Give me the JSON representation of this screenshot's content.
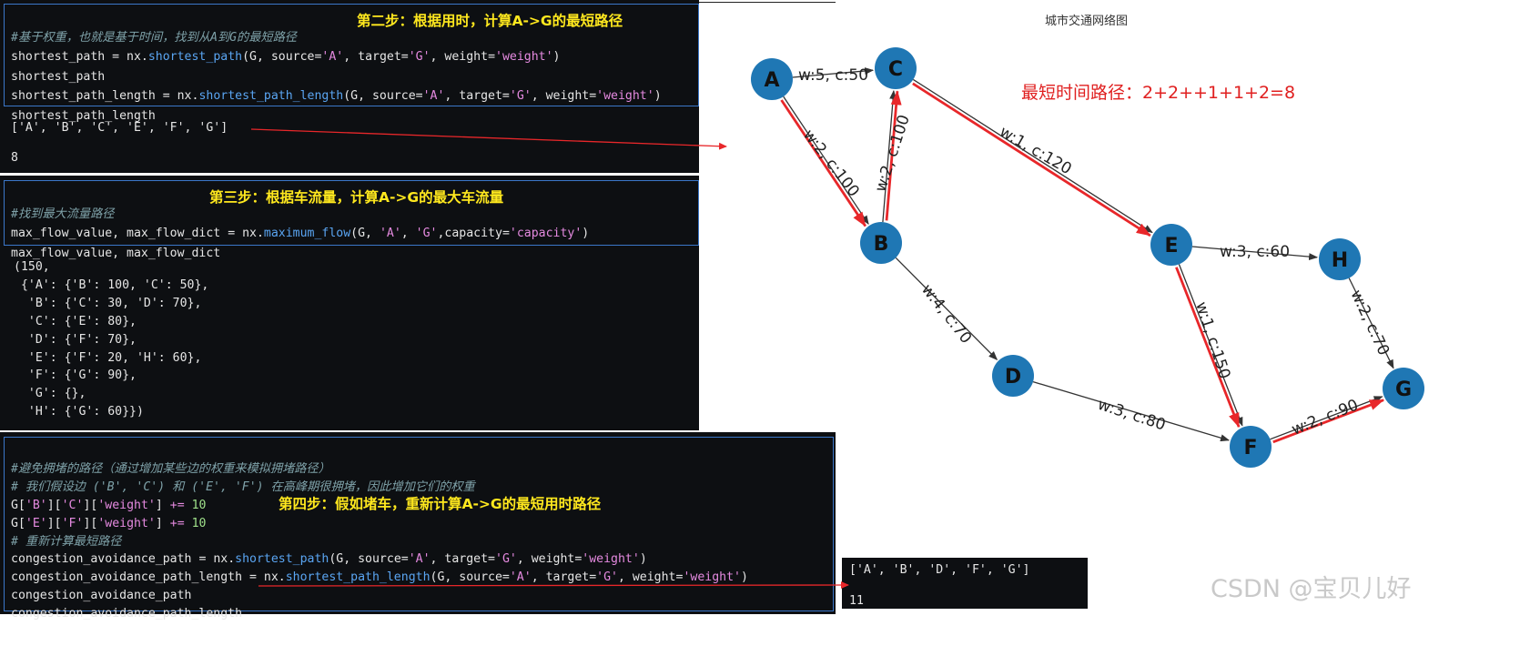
{
  "graph": {
    "title": "城市交通网络图",
    "path_note": "最短时间路径：2+2++1+1+2=8",
    "nodes": [
      {
        "id": "A"
      },
      {
        "id": "B"
      },
      {
        "id": "C"
      },
      {
        "id": "D"
      },
      {
        "id": "E"
      },
      {
        "id": "F"
      },
      {
        "id": "G"
      },
      {
        "id": "H"
      }
    ],
    "edges": [
      {
        "from": "A",
        "to": "B",
        "label": "w:2,  c:100",
        "highlight": true
      },
      {
        "from": "A",
        "to": "C",
        "label": "w:5,  c:50",
        "highlight": false
      },
      {
        "from": "B",
        "to": "C",
        "label": "w:2,  c:100",
        "highlight": true
      },
      {
        "from": "B",
        "to": "D",
        "label": "w:4,  c:70",
        "highlight": false
      },
      {
        "from": "C",
        "to": "E",
        "label": "w:1,  c:120",
        "highlight": true
      },
      {
        "from": "D",
        "to": "F",
        "label": "w:3,  c:80",
        "highlight": false
      },
      {
        "from": "E",
        "to": "F",
        "label": "w:1,  c:150",
        "highlight": true
      },
      {
        "from": "E",
        "to": "H",
        "label": "w:3,  c:60",
        "highlight": false
      },
      {
        "from": "F",
        "to": "G",
        "label": "w:2,  c:90",
        "highlight": true
      },
      {
        "from": "H",
        "to": "G",
        "label": "w:2,  c:70",
        "highlight": false
      }
    ],
    "colors": {
      "node": "#1f77b4",
      "edge": "#333333",
      "highlight": "#e8272a"
    }
  },
  "steps": {
    "step2": "第二步：根据用时，计算A->G的最短路径",
    "step3": "第三步：根据车流量，计算A->G的最大车流量",
    "step4": "第四步：假如堵车，重新计算A->G的最短用时路径"
  },
  "cell1": {
    "comment": "#基于权重，也就是基于时间，找到从A到G的最短路径",
    "l1": {
      "var": "shortest_path",
      "eq": " = nx.",
      "fn": "shortest_path",
      "a1": "(G, source=",
      "s1": "'A'",
      "a2": ", target=",
      "s2": "'G'",
      "a3": ", weight=",
      "s3": "'weight'",
      "a4": ")"
    },
    "l2": "shortest_path",
    "l3": {
      "var": "shortest_path_length",
      "eq": " = nx.",
      "fn": "shortest_path_length",
      "a1": "(G, source=",
      "s1": "'A'",
      "a2": ", target=",
      "s2": "'G'",
      "a3": ", weight=",
      "s3": "'weight'",
      "a4": ")"
    },
    "l4": "shortest_path_length",
    "out1": "['A', 'B', 'C', 'E', 'F', 'G']",
    "out2": "8"
  },
  "cell2": {
    "comment": "#找到最大流量路径",
    "l1": {
      "var": "max_flow_value, max_flow_dict",
      "eq": " = nx.",
      "fn": "maximum_flow",
      "a1": "(G, ",
      "s1": "'A'",
      "a2": ", ",
      "s2": "'G'",
      "a3": ",capacity=",
      "s3": "'capacity'",
      "a4": ")"
    },
    "l2": "max_flow_value, max_flow_dict",
    "out": [
      "(150,",
      " {'A': {'B': 100, 'C': 50},",
      "  'B': {'C': 30, 'D': 70},",
      "  'C': {'E': 80},",
      "  'D': {'F': 70},",
      "  'E': {'F': 20, 'H': 60},",
      "  'F': {'G': 90},",
      "  'G': {},",
      "  'H': {'G': 60}})"
    ]
  },
  "cell3": {
    "comment1": "#避免拥堵的路径（通过增加某些边的权重来模拟拥堵路径）",
    "comment2": "# 我们假设边 ('B', 'C') 和 ('E', 'F') 在高峰期很拥堵，因此增加它们的权重",
    "l1": {
      "a": "G[",
      "s1": "'B'",
      "b": "][",
      "s2": "'C'",
      "c": "][",
      "s3": "'weight'",
      "d": "] ",
      "op": "+=",
      "sp": " ",
      "n": "10"
    },
    "l2": {
      "a": "G[",
      "s1": "'E'",
      "b": "][",
      "s2": "'F'",
      "c": "][",
      "s3": "'weight'",
      "d": "] ",
      "op": "+=",
      "sp": " ",
      "n": "10"
    },
    "comment3": "# 重新计算最短路径",
    "l3": {
      "var": "congestion_avoidance_path",
      "eq": " = nx.",
      "fn": "shortest_path",
      "a1": "(G, source=",
      "s1": "'A'",
      "a2": ", target=",
      "s2": "'G'",
      "a3": ", weight=",
      "s3": "'weight'",
      "a4": ")"
    },
    "l4": {
      "var": "congestion_avoidance_path_length",
      "eq": " = nx.",
      "fn": "shortest_path_length",
      "a1": "(G, source=",
      "s1": "'A'",
      "a2": ", target=",
      "s2": "'G'",
      "a3": ", weight=",
      "s3": "'weight'",
      "a4": ")"
    },
    "l5": "congestion_avoidance_path",
    "l6": "congestion_avoidance_path_length"
  },
  "result3": {
    "out1": "['A', 'B', 'D', 'F', 'G']",
    "out2": "11"
  },
  "watermark": "CSDN @宝贝儿好"
}
